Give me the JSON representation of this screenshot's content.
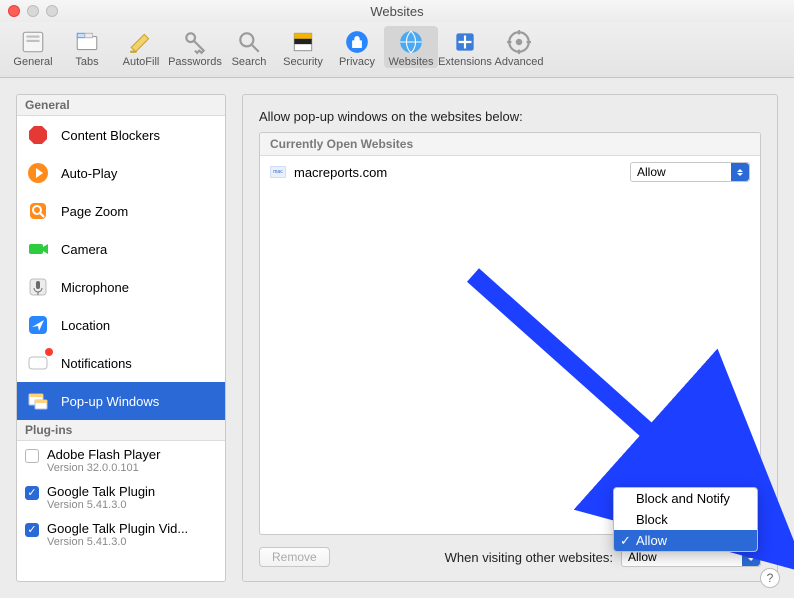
{
  "window": {
    "title": "Websites"
  },
  "toolbar": [
    {
      "id": "general",
      "label": "General"
    },
    {
      "id": "tabs",
      "label": "Tabs"
    },
    {
      "id": "autofill",
      "label": "AutoFill"
    },
    {
      "id": "passwords",
      "label": "Passwords"
    },
    {
      "id": "search",
      "label": "Search"
    },
    {
      "id": "security",
      "label": "Security"
    },
    {
      "id": "privacy",
      "label": "Privacy"
    },
    {
      "id": "websites",
      "label": "Websites",
      "selected": true
    },
    {
      "id": "extensions",
      "label": "Extensions"
    },
    {
      "id": "advanced",
      "label": "Advanced"
    }
  ],
  "sidebar": {
    "sections": [
      {
        "title": "General",
        "items": [
          {
            "icon": "stop",
            "label": "Content Blockers"
          },
          {
            "icon": "play",
            "label": "Auto-Play"
          },
          {
            "icon": "zoom",
            "label": "Page Zoom"
          },
          {
            "icon": "camera",
            "label": "Camera"
          },
          {
            "icon": "mic",
            "label": "Microphone"
          },
          {
            "icon": "location",
            "label": "Location"
          },
          {
            "icon": "notif",
            "label": "Notifications",
            "badge": true
          },
          {
            "icon": "popup",
            "label": "Pop-up Windows",
            "selected": true
          }
        ]
      },
      {
        "title": "Plug-ins",
        "plugins": [
          {
            "name": "Adobe Flash Player",
            "version": "Version 32.0.0.101",
            "enabled": false
          },
          {
            "name": "Google Talk Plugin",
            "version": "Version 5.41.3.0",
            "enabled": true
          },
          {
            "name": "Google Talk Plugin Vid...",
            "version": "Version 5.41.3.0",
            "enabled": true
          }
        ]
      }
    ]
  },
  "main": {
    "title": "Allow pop-up windows on the websites below:",
    "list_header": "Currently Open Websites",
    "rows": [
      {
        "site": "macreports.com",
        "setting": "Allow"
      }
    ],
    "remove_label": "Remove",
    "footer_label": "When visiting other websites:",
    "footer_value": "Allow"
  },
  "popup_menu": {
    "items": [
      "Block and Notify",
      "Block",
      "Allow"
    ],
    "selected": "Allow"
  },
  "help_glyph": "?"
}
